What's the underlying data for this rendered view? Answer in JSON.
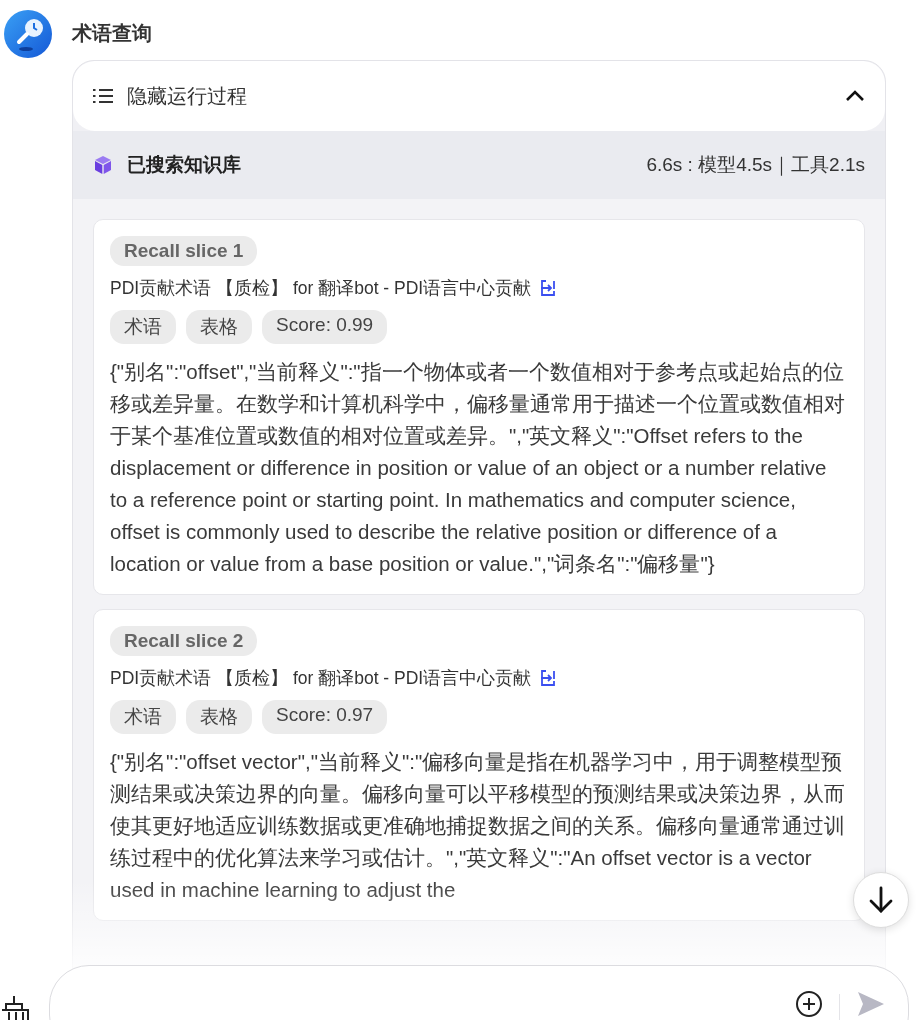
{
  "agent": {
    "name": "术语查询"
  },
  "process": {
    "toggle_label": "隐藏运行过程",
    "expanded": true,
    "step": {
      "label": "已搜索知识库",
      "timing": "6.6s : 模型4.5s｜工具2.1s"
    },
    "slices": [
      {
        "badge": "Recall slice 1",
        "source": "PDI贡献术语 【质检】 for 翻译bot - PDI语言中心贡献",
        "tags": [
          "术语",
          "表格",
          "Score: 0.99"
        ],
        "content": "{\"别名\":\"offset\",\"当前释义\":\"指一个物体或者一个数值相对于参考点或起始点的位移或差异量。在数学和计算机科学中，偏移量通常用于描述一个位置或数值相对于某个基准位置或数值的相对位置或差异。\",\"英文释义\":\"Offset refers to the displacement or difference in position or value of an object or a number relative to a reference point or starting point. In mathematics and computer science, offset is commonly used to describe the relative position or difference of a location or value from a base position or value.\",\"词条名\":\"偏移量\"}"
      },
      {
        "badge": "Recall slice 2",
        "source": "PDI贡献术语 【质检】 for 翻译bot - PDI语言中心贡献",
        "tags": [
          "术语",
          "表格",
          "Score: 0.97"
        ],
        "content": "{\"别名\":\"offset vector\",\"当前释义\":\"偏移向量是指在机器学习中，用于调整模型预测结果或决策边界的向量。偏移向量可以平移模型的预测结果或决策边界，从而使其更好地适应训练数据或更准确地捕捉数据之间的关系。偏移向量通常通过训练过程中的优化算法来学习或估计。\",\"英文释义\":\"An offset vector is a vector used in machine learning to adjust the"
      }
    ]
  }
}
